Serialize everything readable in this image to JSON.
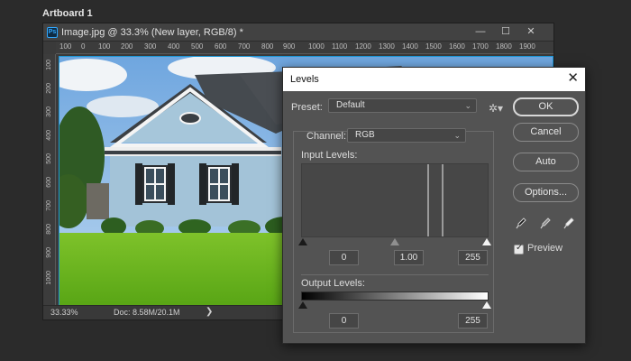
{
  "artboard": {
    "label": "Artboard 1"
  },
  "document": {
    "title": "Image.jpg @ 33.3% (New layer, RGB/8) *",
    "controls": {
      "minimize": "—",
      "maximize": "☐",
      "close": "✕"
    },
    "ruler_h": [
      "100",
      "0",
      "100",
      "200",
      "300",
      "400",
      "500",
      "600",
      "700",
      "800",
      "900",
      "1000",
      "1100",
      "1200",
      "1300",
      "1400",
      "1500",
      "1600",
      "1700",
      "1800",
      "1900"
    ],
    "ruler_v": [
      "100",
      "200",
      "300",
      "400",
      "500",
      "600",
      "700",
      "800",
      "900",
      "1000"
    ],
    "status": {
      "zoom": "33.33%",
      "doc_size": "Doc: 8.58M/20.1M",
      "arrow": "❯"
    }
  },
  "levels": {
    "title": "Levels",
    "close": "✕",
    "preset_label": "Preset:",
    "preset_value": "Default",
    "channel_label": "Channel:",
    "channel_value": "RGB",
    "input_label": "Input Levels:",
    "input_values": {
      "black": "0",
      "gamma": "1.00",
      "white": "255"
    },
    "output_label": "Output Levels:",
    "output_values": {
      "black": "0",
      "white": "255"
    },
    "buttons": {
      "ok": "OK",
      "cancel": "Cancel",
      "auto": "Auto",
      "options": "Options..."
    },
    "preview_label": "Preview",
    "preview_checked": true,
    "icons": {
      "gear": "gear-icon",
      "eyedroppers": [
        "black-point-eyedropper-icon",
        "gray-point-eyedropper-icon",
        "white-point-eyedropper-icon"
      ]
    }
  }
}
